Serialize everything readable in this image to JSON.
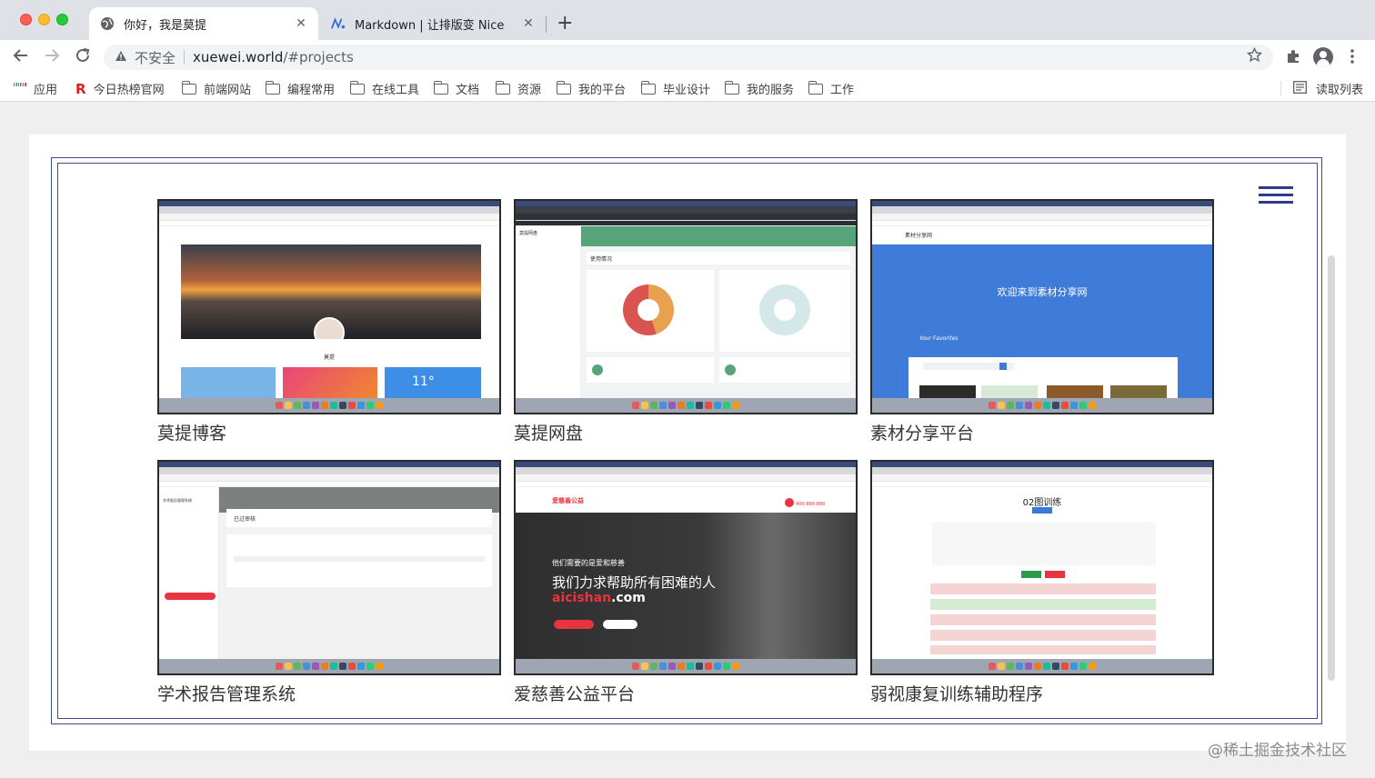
{
  "browser": {
    "tabs": [
      {
        "title": "你好，我是莫提",
        "active": true,
        "icon": "globe-icon"
      },
      {
        "title": "Markdown | 让排版变 Nice",
        "active": false,
        "icon": "nice-logo-icon"
      }
    ],
    "new_tab_glyph": "+",
    "close_glyph": "✕",
    "address": {
      "security_label": "不安全",
      "host": "xuewei.world",
      "path": "/#projects"
    },
    "bookmarks": [
      {
        "label": "应用",
        "icon": "apps-grid-icon"
      },
      {
        "label": "今日热榜官网",
        "icon": "r-logo-icon"
      },
      {
        "label": "前端网站",
        "icon": "folder-icon"
      },
      {
        "label": "编程常用",
        "icon": "folder-icon"
      },
      {
        "label": "在线工具",
        "icon": "folder-icon"
      },
      {
        "label": "文档",
        "icon": "folder-icon"
      },
      {
        "label": "资源",
        "icon": "folder-icon"
      },
      {
        "label": "我的平台",
        "icon": "folder-icon"
      },
      {
        "label": "毕业设计",
        "icon": "folder-icon"
      },
      {
        "label": "我的服务",
        "icon": "folder-icon"
      },
      {
        "label": "工作",
        "icon": "folder-icon"
      }
    ],
    "reading_list": "读取列表",
    "r_logo_glyph": "R"
  },
  "projects": [
    {
      "name": "莫提博客",
      "preview": "blog"
    },
    {
      "name": "莫提网盘",
      "preview": "netdisk"
    },
    {
      "name": "素材分享平台",
      "preview": "material"
    },
    {
      "name": "学术报告管理系统",
      "preview": "report"
    },
    {
      "name": "爱慈善公益平台",
      "preview": "charity"
    },
    {
      "name": "弱视康复训练辅助程序",
      "preview": "training"
    }
  ],
  "previews": {
    "blog": {
      "title_text": "莫提",
      "weather": "11°"
    },
    "netdisk": {
      "logo": "莫提网盘",
      "panel_title": "使用情况"
    },
    "material": {
      "logo": "素材分享网",
      "hero": "欢迎来到素材分享网",
      "script_text": "Your Favorites"
    },
    "report": {
      "system_title": "学术报告管理系统",
      "panel_title": "已过审核"
    },
    "charity": {
      "logo": "爱慈善公益",
      "phone": "400-888-888",
      "line1": "他们需要的是爱和慈善",
      "line2": "我们力求帮助所有困难的人",
      "brand": "aicishan",
      "domain": ".com"
    },
    "training": {
      "heading": "02图训练"
    }
  },
  "watermark": "@稀土掘金技术社区",
  "colors": {
    "accent_navy": "#2e3a8c",
    "frame": "#3d4b91",
    "netdisk_green": "#58a47a",
    "material_blue": "#3f7bd8",
    "charity_red": "#e8343f"
  }
}
